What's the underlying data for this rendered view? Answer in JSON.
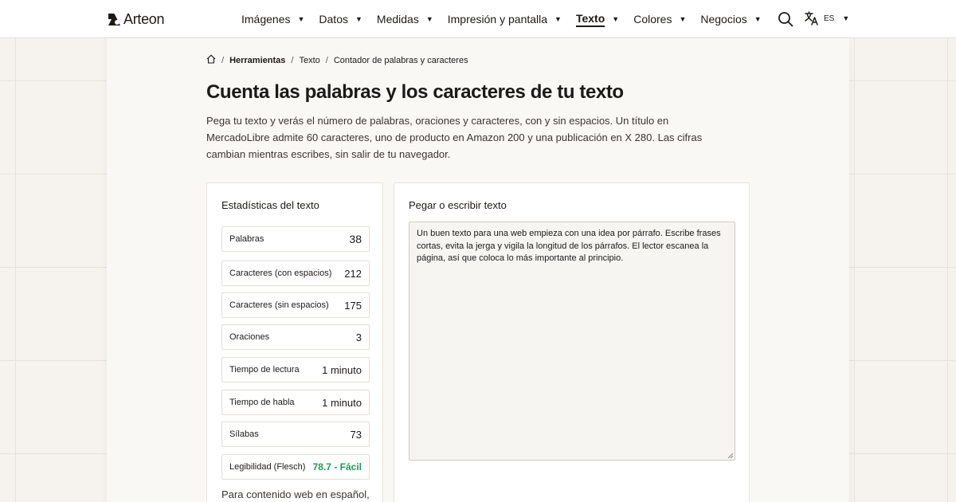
{
  "header": {
    "logo_text": "Arteon",
    "nav": [
      {
        "label": "Imágenes",
        "active": false
      },
      {
        "label": "Datos",
        "active": false
      },
      {
        "label": "Medidas",
        "active": false
      },
      {
        "label": "Impresión y pantalla",
        "active": false
      },
      {
        "label": "Texto",
        "active": true
      },
      {
        "label": "Colores",
        "active": false
      },
      {
        "label": "Negocios",
        "active": false
      }
    ],
    "caret": "▼",
    "language": "ES",
    "icons": {
      "search": "search-icon",
      "translate": "translate-icon",
      "home": "home-icon"
    }
  },
  "breadcrumb": {
    "sep": "/",
    "items": [
      "Herramientas",
      "Texto",
      "Contador de palabras y caracteres"
    ]
  },
  "page": {
    "title": "Cuenta las palabras y los caracteres de tu texto",
    "intro": "Pega tu texto y verás el número de palabras, oraciones y caracteres, con y sin espacios. Un título en MercadoLibre admite 60 caracteres, uno de producto en Amazon 200 y una publicación en X 280. Las cifras cambian mientras escribes, sin salir de tu navegador."
  },
  "stats": {
    "title": "Estadísticas del texto",
    "rows": [
      {
        "label": "Palabras",
        "value": "38"
      },
      {
        "label": "Caracteres (con espacios)",
        "value": "212"
      },
      {
        "label": "Caracteres (sin espacios)",
        "value": "175"
      },
      {
        "label": "Oraciones",
        "value": "3"
      },
      {
        "label": "Tiempo de lectura",
        "value": "1 minuto"
      },
      {
        "label": "Tiempo de habla",
        "value": "1 minuto"
      },
      {
        "label": "Sílabas",
        "value": "73"
      },
      {
        "label": "Legibilidad (Flesch)",
        "value": "78.7 - Fácil"
      }
    ],
    "footer": "Para contenido web en español,"
  },
  "editor": {
    "title": "Pegar o escribir texto",
    "value": "Un buen texto para una web empieza con una idea por párrafo. Escribe frases cortas, evita la jerga y vigila la longitud de los párrafos. El lector escanea la página, así que coloca lo más importante al principio."
  },
  "colors": {
    "accent_green": "#1f9a5a",
    "text": "#1c1a17",
    "background": "#f6f3ef"
  }
}
